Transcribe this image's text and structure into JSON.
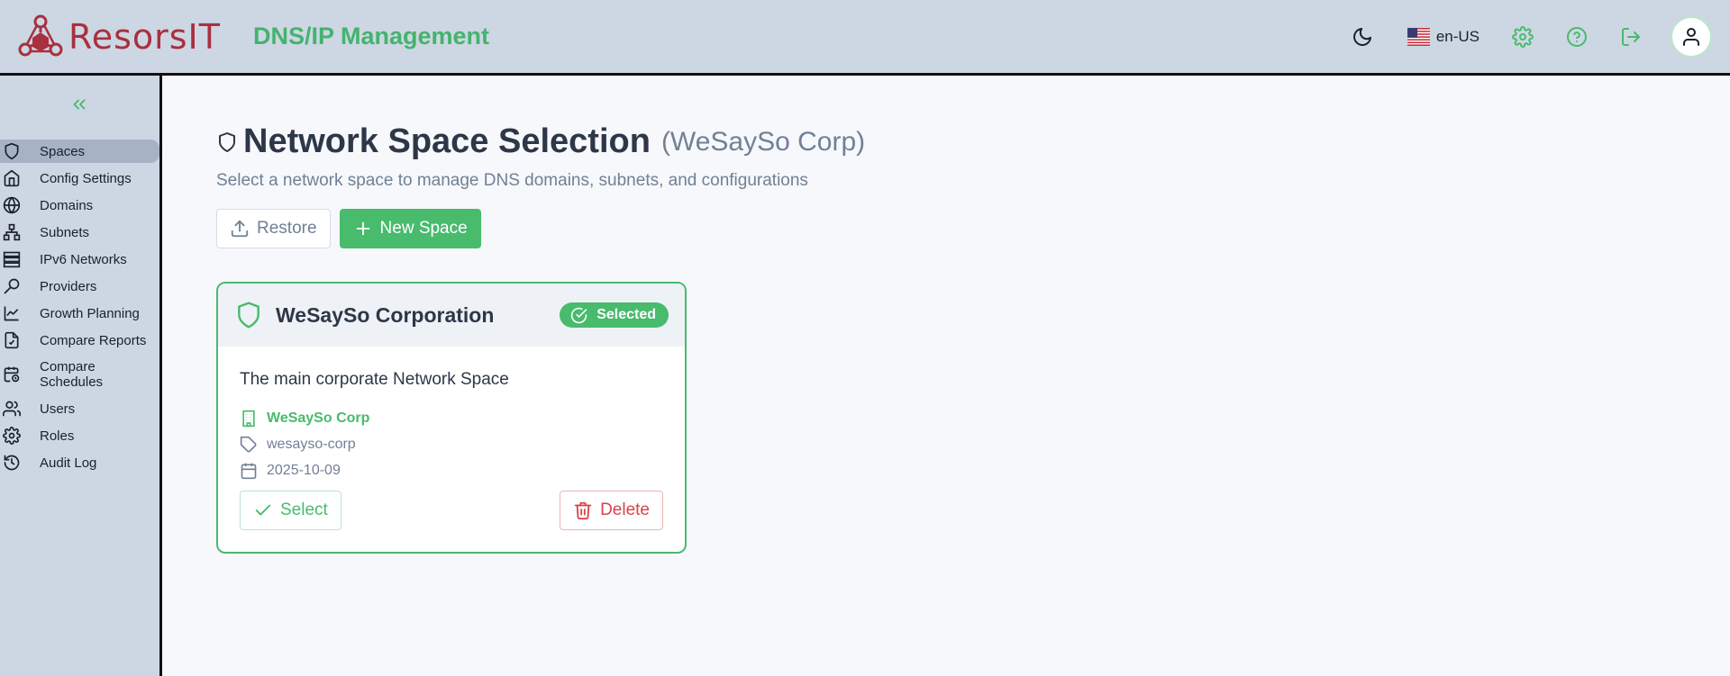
{
  "header": {
    "logo_text": "ResorsIT",
    "app_title": "DNS/IP Management",
    "language": "en-US",
    "icons": [
      "moon-icon",
      "us-flag-icon",
      "gear-icon",
      "help-icon",
      "logout-icon",
      "user-icon"
    ]
  },
  "sidebar": {
    "collapse_icon": "chevrons-left-icon",
    "items": [
      {
        "label": "Spaces",
        "icon": "shield-icon",
        "active": true
      },
      {
        "label": "Config Settings",
        "icon": "home-icon"
      },
      {
        "label": "Domains",
        "icon": "globe-icon"
      },
      {
        "label": "Subnets",
        "icon": "network-icon"
      },
      {
        "label": "IPv6 Networks",
        "icon": "server-icon"
      },
      {
        "label": "Providers",
        "icon": "key-icon"
      },
      {
        "label": "Growth Planning",
        "icon": "trend-icon"
      },
      {
        "label": "Compare Reports",
        "icon": "file-check-icon"
      },
      {
        "label": "Compare Schedules",
        "icon": "calendar-clock-icon"
      },
      {
        "label": "Users",
        "icon": "users-icon"
      },
      {
        "label": "Roles",
        "icon": "gear-icon"
      },
      {
        "label": "Audit Log",
        "icon": "history-icon"
      }
    ]
  },
  "main": {
    "title": "Network Space Selection",
    "subtitle": "(WeSaySo Corp)",
    "description": "Select a network space to manage DNS domains, subnets, and configurations",
    "restore_label": "Restore",
    "new_space_label": "New Space"
  },
  "card": {
    "title": "WeSaySo Corporation",
    "badge": "Selected",
    "description": "The main corporate Network Space",
    "organization": "WeSaySo Corp",
    "slug": "wesayso-corp",
    "date": "2025-10-09",
    "select_label": "Select",
    "delete_label": "Delete"
  },
  "colors": {
    "accent_green": "#48bb6c",
    "brand_red": "#a8303f",
    "danger": "#d9434a",
    "chrome": "#cdd7e3"
  }
}
